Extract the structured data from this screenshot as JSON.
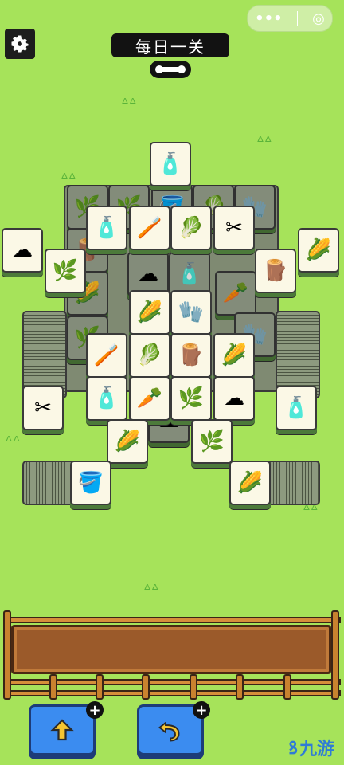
{
  "header": {
    "title": "每日一关",
    "capsule_more": "•••",
    "capsule_close": "◎"
  },
  "tray": {
    "slots_filled": 0
  },
  "buttons": {
    "shuffle_plus": "+",
    "undo_plus": "+"
  },
  "watermark": {
    "text": "九游"
  },
  "tiles": {
    "top_bottle": "🧴",
    "cotton": "☁",
    "bottle": "🧴",
    "brush": "🪥",
    "cabbage": "🥬",
    "scissors": "✂",
    "corn": "🌽",
    "grass": "🌿",
    "stump": "🪵",
    "glove": "🧤",
    "carrot": "🥕",
    "bucket": "🪣"
  },
  "colors": {
    "background": "#a6e35a",
    "tile_face": "#fbf8e6",
    "button": "#3b8cf0"
  }
}
